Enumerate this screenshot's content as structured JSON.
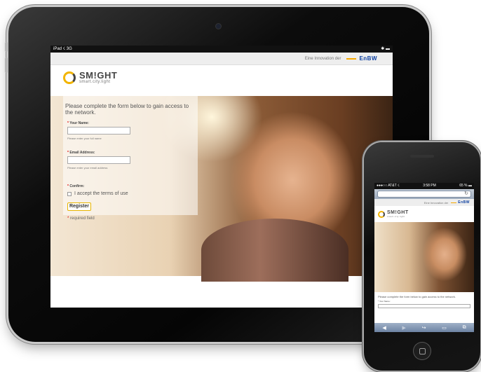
{
  "ipad": {
    "status": {
      "left": "iPad ☇ 3G",
      "right": "✱ ▬"
    },
    "enbw": {
      "text": "Eine Innovation der",
      "brand": "EnBW"
    },
    "logo": {
      "title": "SM!GHT",
      "subtitle": "smart.city.light"
    },
    "intro": "Please complete the form below to gain access to the network.",
    "fields": {
      "name": {
        "label": "Your Name:",
        "hint": "Please enter your full name"
      },
      "email": {
        "label": "Email Address:",
        "hint": "Please enter your email address"
      },
      "confirm": {
        "label": "Confirm:"
      }
    },
    "terms_label": "I accept the terms of use",
    "register_label": "Register",
    "required_note": "required field",
    "required_mark": "*"
  },
  "iphone": {
    "status": {
      "left": "●●●○○ AT&T ☇",
      "center": "3:58 PM",
      "right": "65 % ▬"
    },
    "reload_icon": "↻",
    "enbw": {
      "text": "Eine Innovation der",
      "brand": "EnBW"
    },
    "logo": {
      "title": "SM!GHT",
      "subtitle": "smart.city.light"
    },
    "intro": "Please complete the form below to gain access to the network.",
    "name_label": "* Your Name:",
    "toolbar": {
      "back": "◀",
      "forward": "▶",
      "share": "↪",
      "bookmarks": "▭",
      "tabs": "⧉"
    }
  },
  "colors": {
    "accent_yellow": "#f2b400",
    "enbw_blue": "#0a3ea0",
    "enbw_orange": "#f6a800"
  }
}
